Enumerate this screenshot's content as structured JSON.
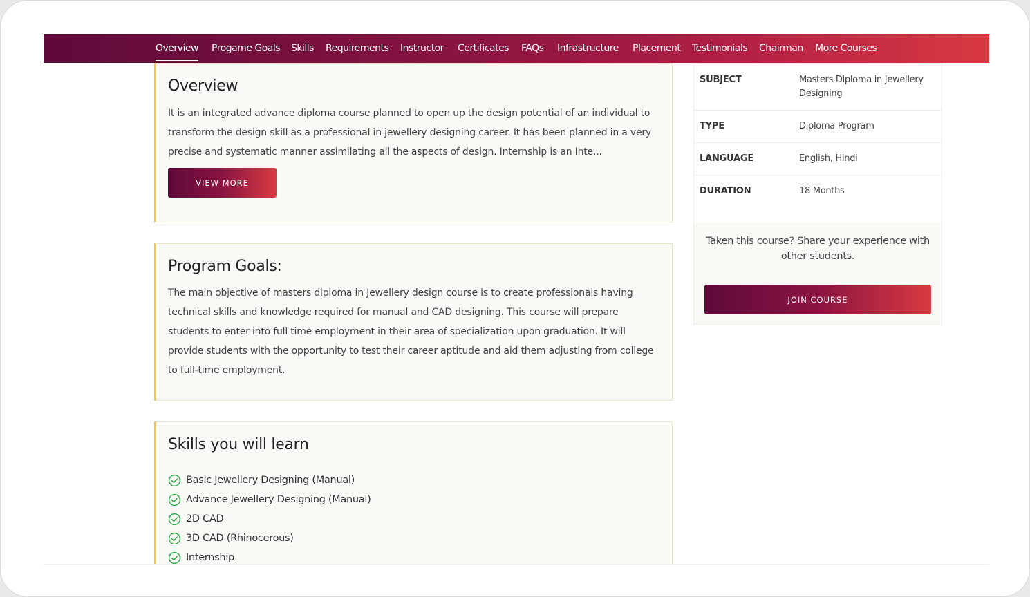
{
  "nav": {
    "items": [
      {
        "label": "Overview",
        "active": true
      },
      {
        "label": "Progame Goals"
      },
      {
        "label": "Skills"
      },
      {
        "label": "Requirements"
      },
      {
        "label": "Instructor"
      },
      {
        "label": "Certificates"
      },
      {
        "label": "FAQs"
      },
      {
        "label": "Infrastructure"
      },
      {
        "label": "Placement"
      },
      {
        "label": "Testimonials"
      },
      {
        "label": "Chairman"
      },
      {
        "label": "More Courses"
      }
    ]
  },
  "overview": {
    "title": "Overview",
    "text": "It is an integrated advance diploma course planned to open up the design potential of an individual to transform the design skill as a professional in jewellery designing career. It has been planned in a very precise and systematic manner assimilating all the aspects of design. Internship is an Inte...",
    "button": "View More"
  },
  "goals": {
    "title": "Program Goals:",
    "text": "The main objective of masters diploma in Jewellery design course is to create professionals having technical skills and knowledge required for manual and CAD designing. This course will prepare students to enter into full time employment in their area of specialization upon graduation. It will provide students with the opportunity to test their career aptitude and aid them adjusting from college to full-time employment."
  },
  "skills": {
    "title": "Skills you will learn",
    "items": [
      "Basic Jewellery Designing (Manual)",
      "Advance Jewellery Designing (Manual)",
      "2D CAD",
      "3D CAD (Rhinocerous)",
      "Internship"
    ]
  },
  "info": {
    "rows": [
      {
        "key": "SUBJECT",
        "value": "Masters Diploma in Jewellery Designing"
      },
      {
        "key": "TYPE",
        "value": "Diploma Program"
      },
      {
        "key": "LANGUAGE",
        "value": "English, Hindi"
      },
      {
        "key": "DURATION",
        "value": "18 Months"
      }
    ],
    "share_text": "Taken this course? Share your experience with other students.",
    "join_button": "Join Course"
  },
  "colors": {
    "nav_gradient_start": "#5e0a3a",
    "nav_gradient_end": "#d93a41",
    "card_accent": "#f3c64a",
    "check_green": "#2ea84a"
  }
}
